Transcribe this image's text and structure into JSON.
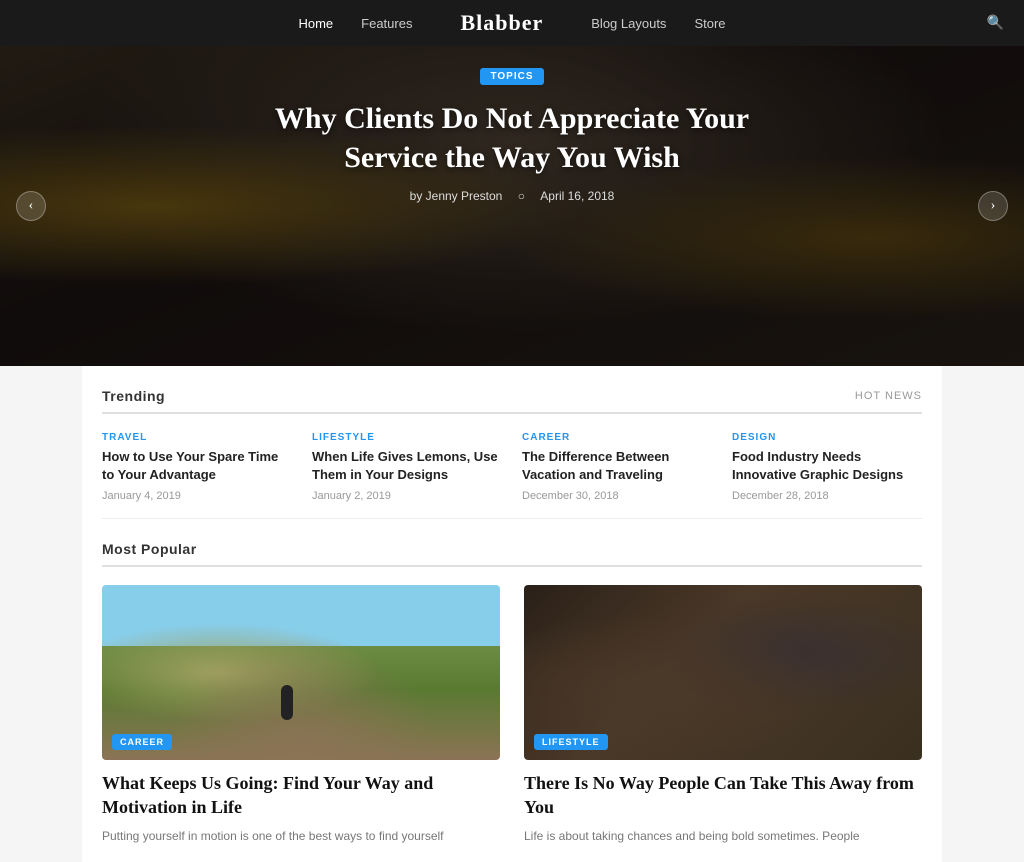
{
  "nav": {
    "logo": "Blabber",
    "links": [
      {
        "label": "Home",
        "active": true
      },
      {
        "label": "Features",
        "active": false
      },
      {
        "label": "Blog Layouts",
        "active": false
      },
      {
        "label": "Store",
        "active": false
      }
    ],
    "search_icon": "🔍"
  },
  "hero": {
    "badge": "TOPICS",
    "title": "Why Clients Do Not Appreciate Your Service the Way You Wish",
    "author": "by Jenny Preston",
    "date": "April 16, 2018",
    "prev_arrow": "‹",
    "next_arrow": "›"
  },
  "trending": {
    "section_title": "Trending",
    "hot_news_label": "HOT NEWS",
    "items": [
      {
        "category": "TRAVEL",
        "title": "How to Use Your Spare Time to Your Advantage",
        "date": "January 4, 2019"
      },
      {
        "category": "LIFESTYLE",
        "title": "When Life Gives Lemons, Use Them in Your Designs",
        "date": "January 2, 2019"
      },
      {
        "category": "CAREER",
        "title": "The Difference Between Vacation and Traveling",
        "date": "December 30, 2018"
      },
      {
        "category": "DESIGN",
        "title": "Food Industry Needs Innovative Graphic Designs",
        "date": "December 28, 2018"
      }
    ]
  },
  "popular": {
    "section_title": "Most Popular",
    "cards": [
      {
        "badge": "CAREER",
        "title": "What Keeps Us Going: Find Your Way and Motivation in Life",
        "excerpt": "Putting yourself in motion is one of the best ways to find yourself",
        "image_type": "running"
      },
      {
        "badge": "LIFESTYLE",
        "title": "There Is No Way People Can Take This Away from You",
        "excerpt": "Life is about taking chances and being bold sometimes. People",
        "image_type": "workshop"
      }
    ]
  }
}
